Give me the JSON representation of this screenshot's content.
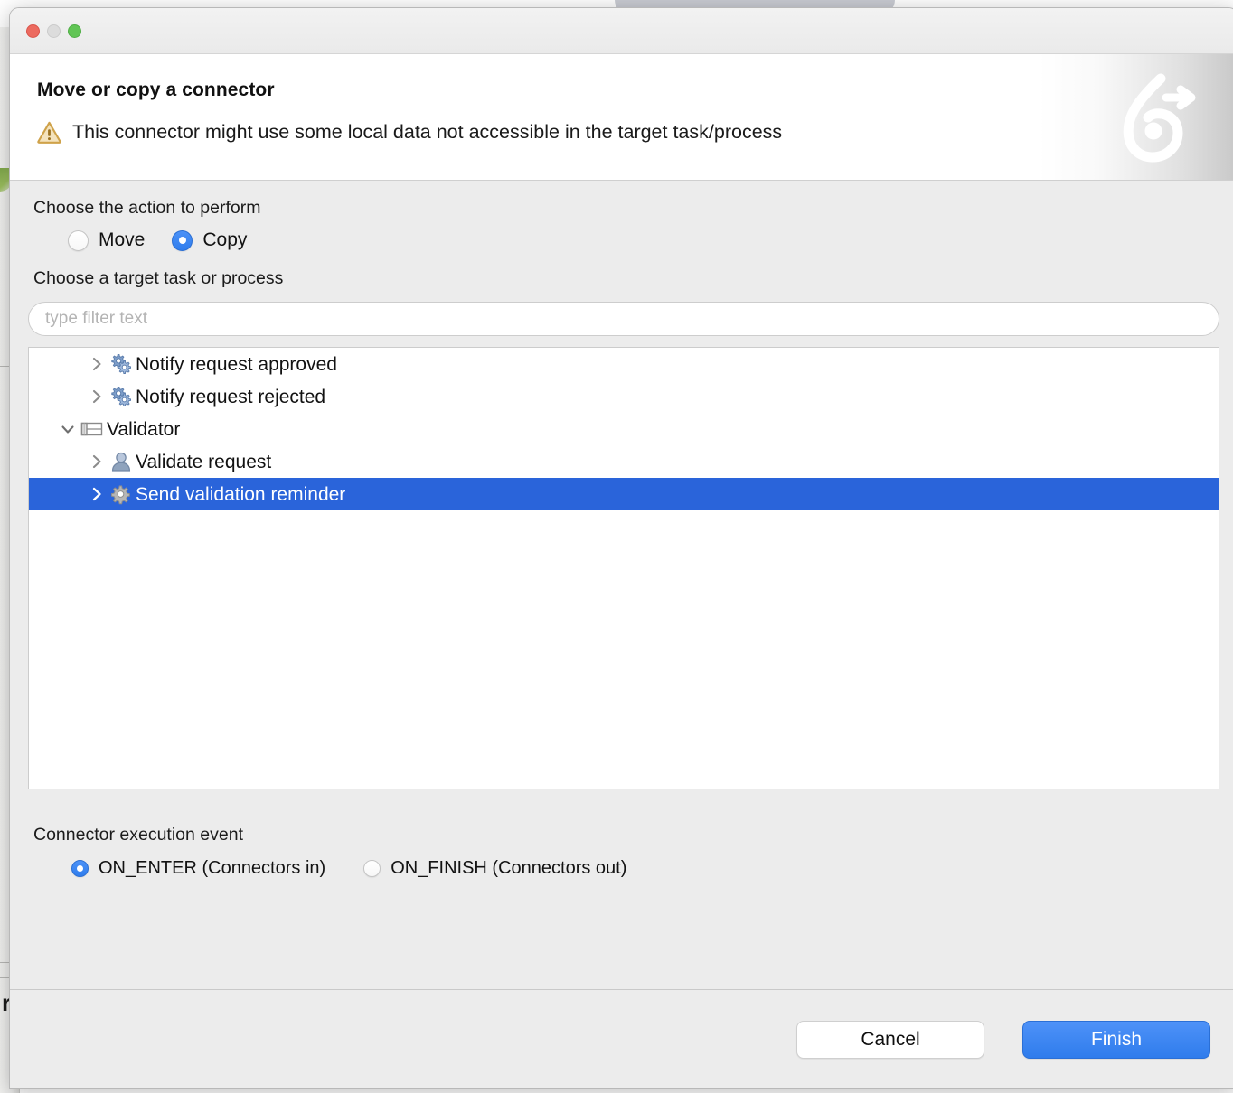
{
  "window": {
    "traffic_lights": [
      "close",
      "minimize",
      "maximize"
    ]
  },
  "header": {
    "title": "Move or copy a connector",
    "message": "This connector might use some local data not accessible in the target task/process",
    "warning_icon": "warning-triangle-icon",
    "brand_icon": "bonita-logo-icon"
  },
  "action_section": {
    "label": "Choose the action to perform",
    "options": [
      {
        "label": "Move",
        "selected": false
      },
      {
        "label": "Copy",
        "selected": true
      }
    ]
  },
  "target_section": {
    "label": "Choose a target task or process",
    "filter": {
      "value": "",
      "placeholder": "type filter text"
    },
    "tree": [
      {
        "label": "Notify request approved",
        "icon": "service-task-gears-icon",
        "indent": 1,
        "twisty": "chevron-right-icon",
        "selected": false
      },
      {
        "label": "Notify request rejected",
        "icon": "service-task-gears-icon",
        "indent": 1,
        "twisty": "chevron-right-icon",
        "selected": false
      },
      {
        "label": "Validator",
        "icon": "lane-icon",
        "indent": 0,
        "twisty": "chevron-down-icon",
        "selected": false
      },
      {
        "label": "Validate request",
        "icon": "human-task-icon",
        "indent": 1,
        "twisty": "chevron-right-icon",
        "selected": false
      },
      {
        "label": "Send validation reminder",
        "icon": "service-task-gear-icon",
        "indent": 1,
        "twisty": "chevron-right-icon",
        "selected": true
      }
    ]
  },
  "event_section": {
    "label": "Connector execution event",
    "options": [
      {
        "label": "ON_ENTER (Connectors in)",
        "selected": true
      },
      {
        "label": "ON_FINISH (Connectors out)",
        "selected": false
      }
    ]
  },
  "footer": {
    "cancel_label": "Cancel",
    "finish_label": "Finish"
  },
  "background": {
    "fragment_text": "r"
  },
  "colors": {
    "accent": "#2f7ded",
    "selection": "#2a64da",
    "dialog_bg": "#ececec",
    "warning": "#d9a441"
  }
}
